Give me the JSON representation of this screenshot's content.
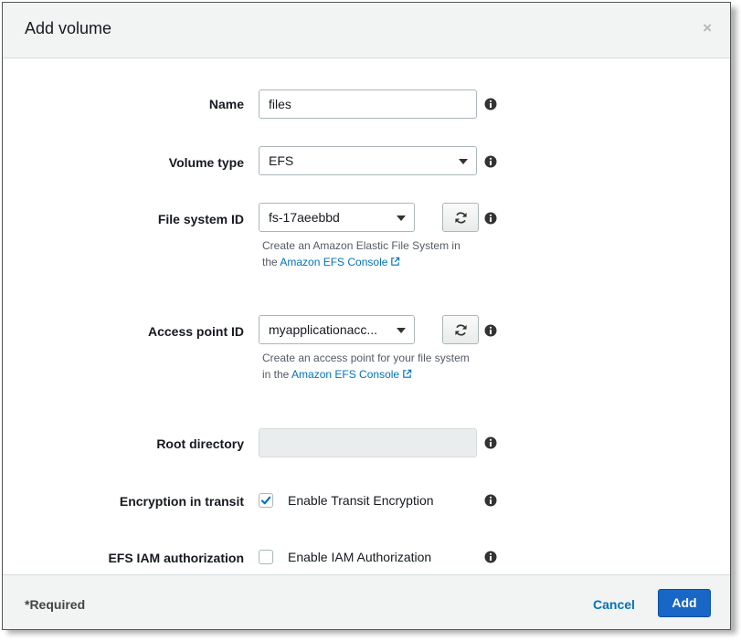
{
  "modal": {
    "title": "Add volume",
    "close_label": "×"
  },
  "form": {
    "name": {
      "label": "Name",
      "value": "files"
    },
    "volume_type": {
      "label": "Volume type",
      "value": "EFS"
    },
    "file_system_id": {
      "label": "File system ID",
      "value": "fs-17aeebbd",
      "hint_line1": "Create an Amazon Elastic File System in",
      "hint_prefix": "the",
      "hint_link": "Amazon EFS Console"
    },
    "access_point_id": {
      "label": "Access point ID",
      "value": "myapplicationacc...",
      "hint_line1": "Create an access point for your file system",
      "hint_prefix": "in the",
      "hint_link": "Amazon EFS Console"
    },
    "root_directory": {
      "label": "Root directory",
      "value": ""
    },
    "encryption_in_transit": {
      "label": "Encryption in transit",
      "checkbox_label": "Enable Transit Encryption",
      "checked": true
    },
    "efs_iam_authorization": {
      "label": "EFS IAM authorization",
      "checkbox_label": "Enable IAM Authorization",
      "checked": false
    }
  },
  "footer": {
    "required_text": "*Required",
    "cancel_label": "Cancel",
    "add_label": "Add"
  },
  "colors": {
    "link": "#0073bb",
    "primary_button": "#1866c5",
    "header_bg": "#f2f3f3",
    "checkbox_check": "#0073bb"
  },
  "icons": [
    "close-icon",
    "info-icon",
    "refresh-icon",
    "external-link-icon",
    "chevron-down-icon",
    "checkmark-icon"
  ]
}
